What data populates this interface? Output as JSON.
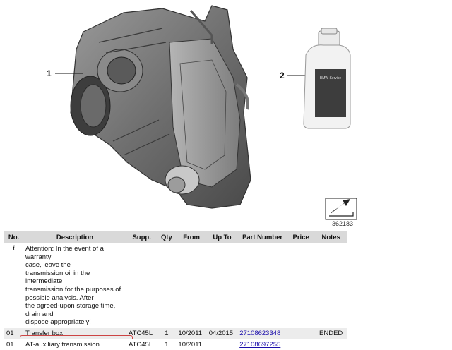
{
  "diagram": {
    "callouts": [
      "1",
      "2"
    ],
    "diagram_id": "362183",
    "bottle_label": "BMW Service",
    "icons": [
      "transfer-box-illustration",
      "oil-bottle-illustration",
      "arrow-stamp-icon"
    ]
  },
  "table": {
    "headers": {
      "no": "No.",
      "description": "Description",
      "supp": "Supp.",
      "qty": "Qty",
      "from": "From",
      "up_to": "Up To",
      "part_number": "Part Number",
      "price": "Price",
      "notes": "Notes"
    },
    "info_row": {
      "no": "i",
      "description_lines": [
        "Attention: In the event of a warranty",
        "case, leave the",
        "transmission oil in the intermediate",
        "transmission for the purposes of",
        "possible analysis. After",
        "the agreed-upon storage time,",
        "drain and",
        "dispose appropriately!"
      ]
    },
    "rows": [
      {
        "no": "01",
        "description": "Transfer box",
        "supp": "ATC45L",
        "qty": "1",
        "from": "10/2011",
        "up_to": "04/2015",
        "part_number": "27108623348",
        "price": "",
        "notes": "ENDED"
      },
      {
        "no": "01",
        "description": "AT-auxiliary transmission",
        "supp": "ATC45L",
        "qty": "1",
        "from": "10/2011",
        "up_to": "",
        "part_number": "27108697255",
        "price": "",
        "notes": ""
      }
    ]
  },
  "colors": {
    "header_bg": "#d9d9d9",
    "row_alt_bg": "#ececec",
    "link": "#1a0dab"
  }
}
